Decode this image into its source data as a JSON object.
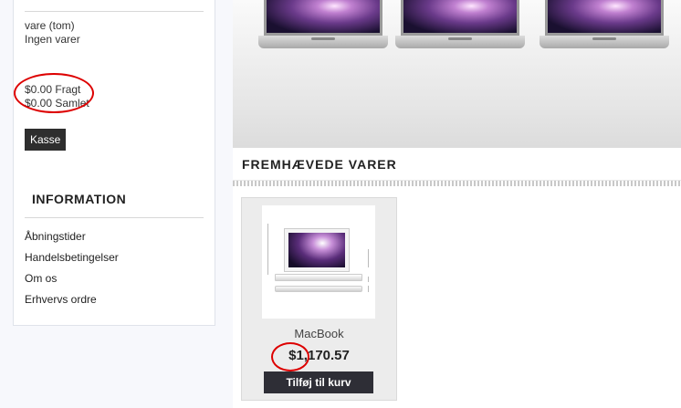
{
  "cart": {
    "items_line": "vare (tom)",
    "empty_line": "Ingen varer",
    "shipping": "$0.00 Fragt",
    "total": "$0.00 Samlet",
    "checkout_label": "Kasse"
  },
  "information": {
    "title": "INFORMATION",
    "links": [
      "Åbningstider",
      "Handelsbetingelser",
      "Om os",
      "Erhvervs ordre"
    ]
  },
  "featured": {
    "title": "FREMHÆVEDE VARER",
    "products": [
      {
        "name": "MacBook",
        "price": "$1,170.57",
        "add_label": "Tilføj til kurv"
      }
    ]
  },
  "annotation_color": "#dd0000"
}
